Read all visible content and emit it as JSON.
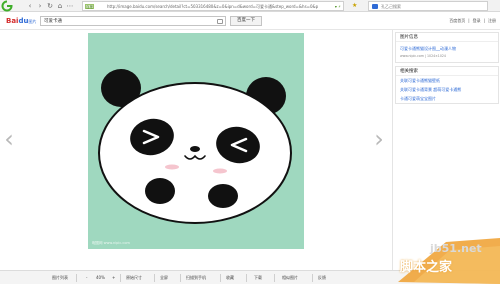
{
  "browser": {
    "address_badge": "百度",
    "url": "http://image.baidu.com/search/detail?ct=503316480&z=0&ipn=d&word=可爱卡通&step_word=&hs=0&p",
    "search_placeholder": "孔乙己搜索"
  },
  "header": {
    "logo_bai": "Bai",
    "logo_du": "du",
    "logo_img": "图片",
    "query": "可爱卡通",
    "search_button": "百度一下",
    "links": [
      "百度首页",
      "登录",
      "注册"
    ]
  },
  "viewer": {
    "prev_arrow": "‹",
    "next_arrow": "›",
    "image_watermark": "昵图网 www.nipic.com"
  },
  "sidebar": {
    "info_heading": "图片信息",
    "info_title": "可爱卡通熊猫设计图__动漫人物",
    "info_meta": "www.nipic.com  |  1024×1024",
    "related_heading": "相关搜索",
    "related_items": [
      "关联可爱卡通熊猫壁纸",
      "关联可爱卡通背景 超萌可爱卡通熊",
      "卡通可爱萌宝宝图片"
    ]
  },
  "statusbar": {
    "items": [
      "图片列表",
      "-",
      "40%",
      "+",
      "原始尺寸",
      "全屏",
      "扫描到手机",
      "收藏",
      "下载",
      "相似图片",
      "反馈"
    ]
  },
  "site_watermark": {
    "url": "jb51.net",
    "name": "脚本之家"
  },
  "colors": {
    "image_background": "#9fd8bf",
    "baidu_red": "#d42d2d",
    "baidu_blue": "#2f6bd6"
  }
}
